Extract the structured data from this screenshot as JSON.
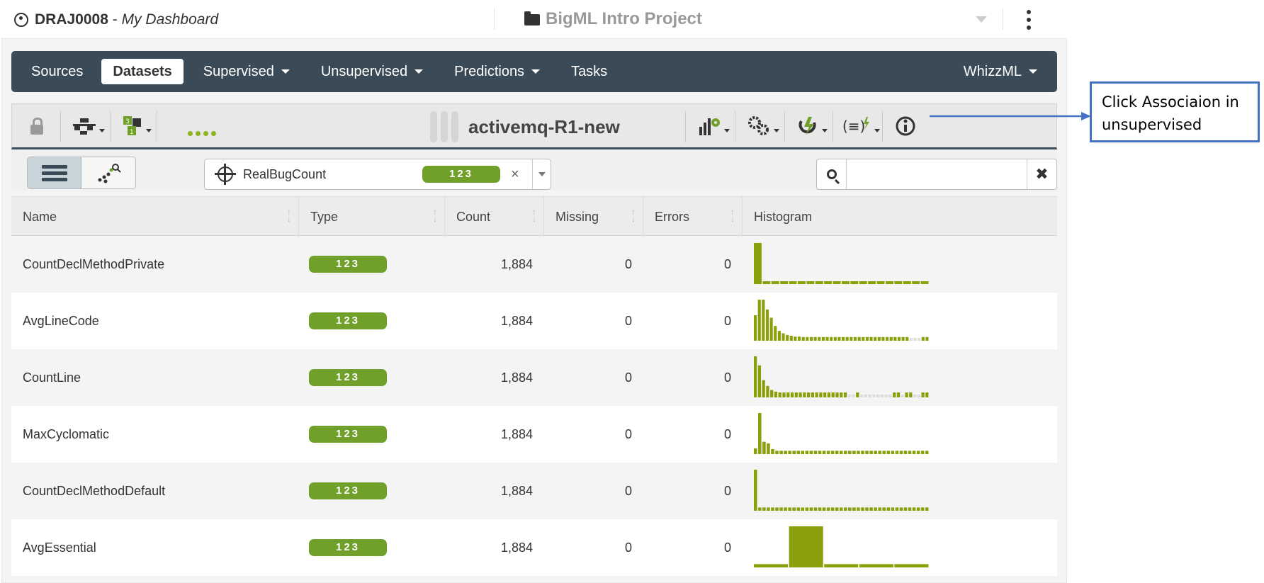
{
  "topbar": {
    "user_id": "DRAJ0008",
    "separator": " - ",
    "dashboard": "My Dashboard",
    "project": "BigML Intro Project",
    "user_icon": "user-circle-icon",
    "project_icon": "folder-icon",
    "menu_icon": "kebab-menu-icon"
  },
  "nav": {
    "items": [
      {
        "label": "Sources",
        "dropdown": false
      },
      {
        "label": "Datasets",
        "dropdown": false,
        "active": true
      },
      {
        "label": "Supervised",
        "dropdown": true
      },
      {
        "label": "Unsupervised",
        "dropdown": true
      },
      {
        "label": "Predictions",
        "dropdown": true
      },
      {
        "label": "Tasks",
        "dropdown": false
      }
    ],
    "right": {
      "label": "WhizzML",
      "dropdown": true
    }
  },
  "dataset": {
    "name": "activemq-R1-new",
    "tools_left": [
      "lock-icon",
      "tree-icon",
      "field-types-icon",
      "dots-icon"
    ],
    "tools_right": [
      "model-config-icon",
      "settings-gears-icon",
      "association-icon",
      "formula-icon",
      "info-icon"
    ]
  },
  "filter": {
    "target_field": "RealBugCount",
    "target_type": "123",
    "clear": "×",
    "search_placeholder": "",
    "search_clear": "✖"
  },
  "table": {
    "columns": [
      "Name",
      "Type",
      "Count",
      "Missing",
      "Errors",
      "Histogram"
    ],
    "rows": [
      {
        "name": "CountDeclMethodPrivate",
        "type": "123",
        "count": "1,884",
        "missing": "0",
        "errors": "0",
        "hist": [
          100,
          6,
          6,
          6,
          6,
          6,
          6,
          6,
          6,
          6,
          6,
          6,
          6,
          6,
          6,
          6,
          6,
          6,
          6,
          6
        ]
      },
      {
        "name": "AvgLineCode",
        "type": "123",
        "count": "1,884",
        "missing": "0",
        "errors": "0",
        "hist": [
          62,
          100,
          100,
          76,
          56,
          36,
          24,
          18,
          14,
          12,
          10,
          10,
          9,
          9,
          9,
          9,
          9,
          9,
          9,
          9,
          9,
          9,
          9,
          9,
          9,
          9,
          9,
          9,
          9,
          9,
          9,
          9,
          9,
          9,
          9,
          9,
          9,
          9,
          9,
          0,
          0,
          0,
          9,
          9
        ]
      },
      {
        "name": "CountLine",
        "type": "123",
        "count": "1,884",
        "missing": "0",
        "errors": "0",
        "hist": [
          100,
          78,
          42,
          28,
          18,
          14,
          12,
          12,
          12,
          12,
          12,
          12,
          12,
          12,
          12,
          12,
          12,
          12,
          12,
          12,
          12,
          12,
          12,
          0,
          0,
          12,
          0,
          0,
          0,
          0,
          0,
          0,
          0,
          0,
          12,
          12,
          0,
          12,
          12,
          0,
          0,
          12,
          12
        ]
      },
      {
        "name": "MaxCyclomatic",
        "type": "123",
        "count": "1,884",
        "missing": "0",
        "errors": "0",
        "hist": [
          14,
          100,
          30,
          26,
          12,
          8,
          8,
          8,
          8,
          8,
          8,
          8,
          8,
          8,
          8,
          8,
          8,
          8,
          8,
          8,
          8,
          8,
          8,
          8,
          8,
          8,
          8,
          8,
          8,
          8,
          8,
          8,
          8,
          8,
          8,
          8,
          8,
          8,
          8,
          8,
          8
        ]
      },
      {
        "name": "CountDeclMethodDefault",
        "type": "123",
        "count": "1,884",
        "missing": "0",
        "errors": "0",
        "hist": [
          100,
          8,
          8,
          8,
          8,
          8,
          8,
          8,
          8,
          8,
          8,
          8,
          8,
          8,
          8,
          8,
          8,
          8,
          8,
          8,
          8,
          8,
          8,
          8,
          8,
          8,
          8,
          8,
          8,
          8,
          8,
          8,
          8,
          8,
          8,
          8,
          8,
          8,
          8,
          8,
          8
        ]
      },
      {
        "name": "AvgEssential",
        "type": "123",
        "count": "1,884",
        "missing": "0",
        "errors": "0",
        "hist": [
          8,
          100,
          8,
          8,
          8
        ]
      }
    ]
  },
  "callout": {
    "line1": "Click Associaion in",
    "line2": "unsupervised"
  },
  "colors": {
    "nav_bg": "#3a4b57",
    "badge_green": "#71a02a",
    "hist_green": "#8a9f0a",
    "callout_border": "#4472c4"
  }
}
